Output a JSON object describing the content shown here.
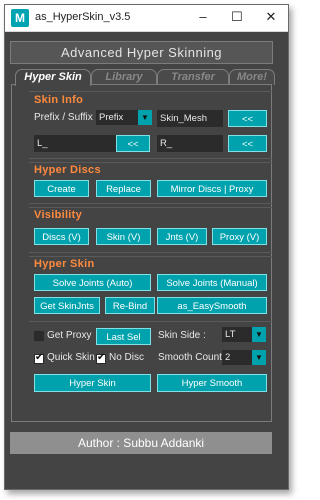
{
  "window": {
    "title": "as_HyperSkin_v3.5",
    "icon_letter": "M",
    "minimize": "–",
    "maximize": "☐",
    "close": "✕"
  },
  "banner": "Advanced Hyper Skinning",
  "tabs": [
    "Hyper Skin",
    "Library",
    "Transfer",
    "More!"
  ],
  "skin_info": {
    "title": "Skin Info",
    "prefix_suffix_label": "Prefix / Suffix :",
    "prefix_suffix_value": "Prefix",
    "mesh_field": "Skin_Mesh",
    "mesh_pick": "<<",
    "left_field": "L_",
    "left_pick": "<<",
    "right_field": "R_",
    "right_pick": "<<"
  },
  "hyper_discs": {
    "title": "Hyper Discs",
    "create": "Create",
    "replace": "Replace",
    "mirror": "Mirror Discs | Proxy"
  },
  "visibility": {
    "title": "Visibility",
    "discs": "Discs (V)",
    "skin": "Skin (V)",
    "jnts": "Jnts (V)",
    "proxy": "Proxy (V)"
  },
  "hyper_skin": {
    "title": "Hyper Skin",
    "solve_auto": "Solve Joints (Auto)",
    "solve_manual": "Solve Joints (Manual)",
    "get_skin_jnts": "Get SkinJnts",
    "rebind": "Re-Bind",
    "easy_smooth": "as_EasySmooth",
    "get_proxy": "Get Proxy",
    "last_sel": "Last Sel",
    "skin_side_label": "Skin Side :",
    "skin_side_value": "LT",
    "quick_skin": "Quick Skin",
    "no_disc": "No Disc",
    "smooth_count_label": "Smooth Count",
    "smooth_count_value": "2",
    "hyper_skin_btn": "Hyper Skin",
    "hyper_smooth_btn": "Hyper Smooth",
    "get_proxy_checked": false,
    "quick_skin_checked": true,
    "no_disc_checked": true
  },
  "footer": "Author : Subbu Addanki",
  "colors": {
    "accent": "#00a3ad",
    "section_title": "#ff8a3d",
    "panel_bg": "#444444"
  }
}
